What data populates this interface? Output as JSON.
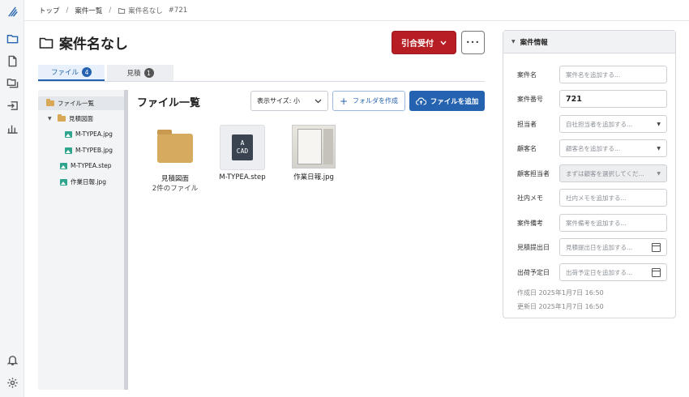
{
  "breadcrumb": {
    "home": "トップ",
    "list": "案件一覧",
    "current": "案件名なし",
    "id": "#721",
    "sep": "/"
  },
  "page": {
    "title": "案件名なし"
  },
  "actions": {
    "primary_label": "引合受付",
    "more_label": "•••"
  },
  "tabs": [
    {
      "label": "ファイル",
      "count": "4"
    },
    {
      "label": "見積",
      "count": "1"
    }
  ],
  "tree": {
    "root": "ファイル一覧",
    "folder": "見積図面",
    "folder_children": [
      "M-TYPEA.jpg",
      "M-TYPEB.jpg"
    ],
    "files": [
      "M-TYPEA.step",
      "作業日報.jpg"
    ]
  },
  "main": {
    "heading": "ファイル一覧",
    "size_select": "表示サイズ: 小",
    "create_folder": "フォルダを作成",
    "add_file": "ファイルを追加",
    "items": [
      {
        "name": "見積図面",
        "sub": "2件のファイル"
      },
      {
        "name": "M-TYPEA.step",
        "sub": ""
      },
      {
        "name": "作業日報.jpg",
        "sub": ""
      }
    ],
    "cad_label_top": "A",
    "cad_label_bottom": "CAD"
  },
  "panel": {
    "title": "案件情報",
    "fields": [
      {
        "label": "案件名",
        "value": "案件名を追加する..."
      },
      {
        "label": "案件番号",
        "value": "721"
      },
      {
        "label": "担当者",
        "value": "自社担当者を追加する..."
      },
      {
        "label": "顧客名",
        "value": "顧客名を追加する..."
      },
      {
        "label": "顧客担当者",
        "value": "まずは顧客を選択してくだ..."
      },
      {
        "label": "社内メモ",
        "value": "社内メモを追加する..."
      },
      {
        "label": "案件備考",
        "value": "案件備考を追加する..."
      },
      {
        "label": "見積提出日",
        "value": "見積提出日を追加する..."
      },
      {
        "label": "出荷予定日",
        "value": "出荷予定日を追加する..."
      }
    ],
    "created": "作成日 2025年1月7日 16:50",
    "updated": "更新日 2025年1月7日 16:50"
  },
  "colors": {
    "accent": "#2563b0",
    "primary_button": "#b61e23"
  }
}
